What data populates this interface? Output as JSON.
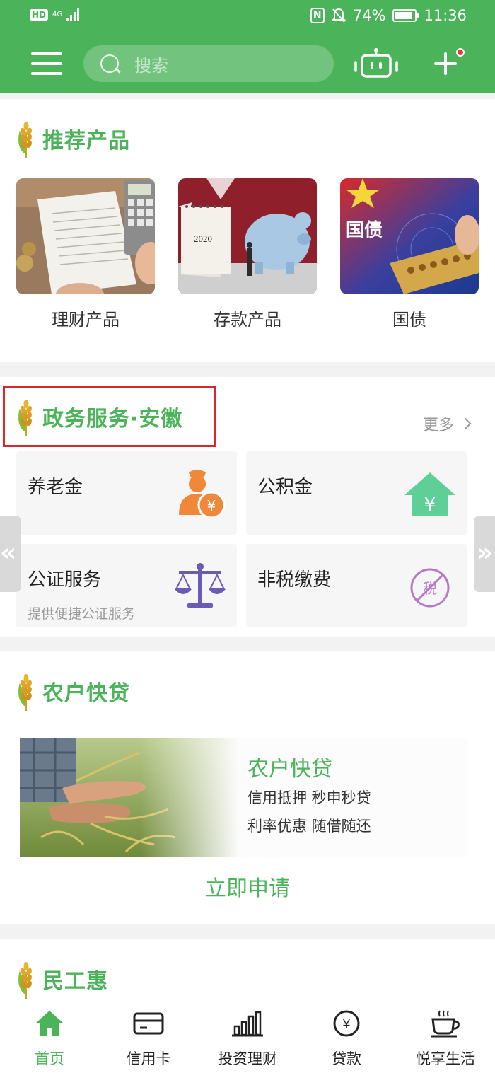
{
  "status_bar": {
    "hd": "HD",
    "network": "4G",
    "battery": "74%",
    "time": "11:36",
    "battery_level": 0.74
  },
  "header": {
    "search_placeholder": "搜索",
    "icons": [
      "menu-icon",
      "search-icon",
      "robot-icon",
      "plus-icon"
    ]
  },
  "recommended": {
    "title": "推荐产品",
    "products": [
      {
        "label": "理财产品",
        "image": "ledger-calculator-photo"
      },
      {
        "label": "存款产品",
        "image": "piggy-bank-photo",
        "calendar_text": "2020"
      },
      {
        "label": "国债",
        "image": "bond-abacus-photo",
        "overlay_text": "国债"
      }
    ]
  },
  "gov_services": {
    "title": "政务服务·安徽",
    "more": "更多",
    "tiles": [
      {
        "title": "养老金",
        "subtitle": "",
        "icon": "pension-person-icon"
      },
      {
        "title": "公积金",
        "subtitle": "",
        "icon": "house-yuan-icon"
      },
      {
        "title": "公证服务",
        "subtitle": "提供便捷公证服务",
        "icon": "scales-icon"
      },
      {
        "title": "非税缴费",
        "subtitle": "",
        "icon": "no-tax-icon",
        "icon_text": "税"
      }
    ],
    "nav_left": "«",
    "nav_right": "»"
  },
  "farmer_loan": {
    "title": "农户快贷",
    "card_title": "农户快贷",
    "features": [
      "信用抵押 秒申秒贷",
      "利率优惠 随借随还"
    ],
    "apply": "立即申请"
  },
  "migrant": {
    "title": "民工惠"
  },
  "bottom_nav": [
    {
      "label": "首页",
      "icon": "home-icon",
      "active": true
    },
    {
      "label": "信用卡",
      "icon": "credit-card-icon",
      "active": false
    },
    {
      "label": "投资理财",
      "icon": "bar-chart-icon",
      "active": false
    },
    {
      "label": "贷款",
      "icon": "yuan-coin-icon",
      "active": false,
      "icon_text": "¥"
    },
    {
      "label": "悦享生活",
      "icon": "coffee-cup-icon",
      "active": false
    }
  ],
  "colors": {
    "brand_green": "#4bb35a",
    "highlight_red": "#d8282f",
    "pension_orange": "#f0883a",
    "house_green": "#5fcf98",
    "scales_purple": "#6b5bb5",
    "no_tax_purple": "#b979c9"
  }
}
